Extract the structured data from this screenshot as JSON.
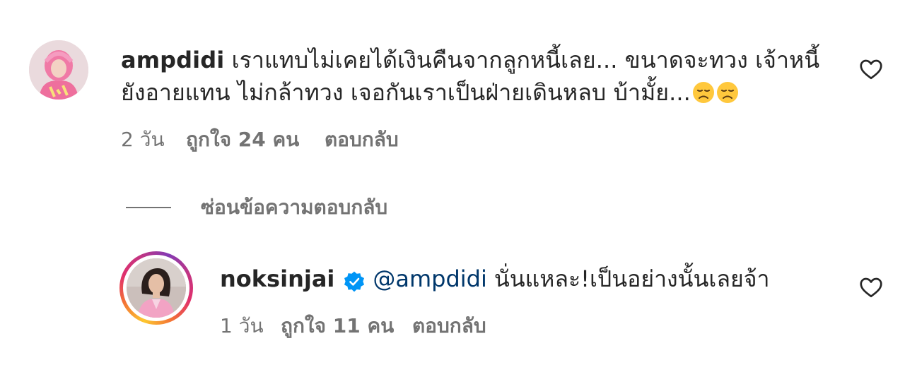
{
  "comment": {
    "username": "ampdidi",
    "text": "เราแทบไม่เคยได้เงินคืนจากลูกหนี้เลย... ขนาดจะทวง เจ้าหนี้ยังอายแทน ไม่กล้าทวง เจอกันเราเป็นฝ่ายเดินหลบ บ้ามั้ย...",
    "emojis": [
      "disappointed-face-emoji",
      "disappointed-face-emoji"
    ],
    "age": "2 วัน",
    "likes": "ถูกใจ 24 คน",
    "reply_label": "ตอบกลับ",
    "like_icon": "heart-outline-icon"
  },
  "hide_replies_label": "ซ่อนข้อความตอบกลับ",
  "reply": {
    "username": "noksinjai",
    "verified": true,
    "mention": "@ampdidi",
    "text": "นั่นแหละ!เป็นอย่างนั้นเลยจ้า",
    "age": "1 วัน",
    "likes": "ถูกใจ 11 คน",
    "reply_label": "ตอบกลับ",
    "like_icon": "heart-outline-icon"
  },
  "colors": {
    "text": "#262626",
    "secondary": "#737373",
    "mention": "#00376b",
    "verified_badge": "#0095f6"
  }
}
